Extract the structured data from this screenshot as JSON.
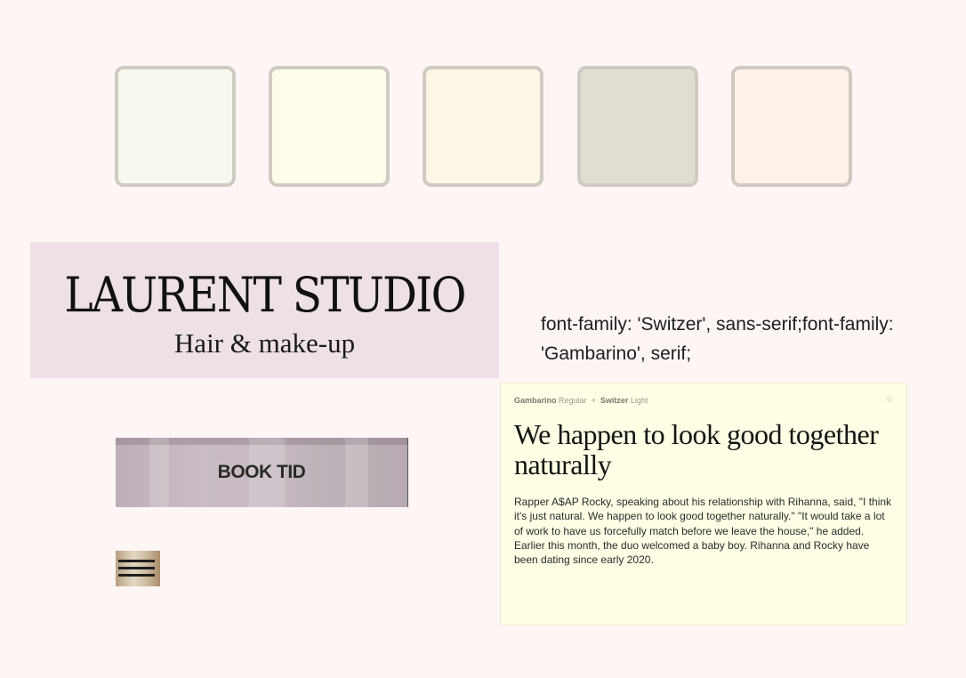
{
  "palette": [
    {
      "color": "#f9f8f0"
    },
    {
      "color": "#fefde9"
    },
    {
      "color": "#fcf6e6"
    },
    {
      "color": "#e2ddd2"
    },
    {
      "color": "#fdf2ea"
    }
  ],
  "brand": {
    "title": "LAURENT STUDIO",
    "subtitle": "Hair & make-up"
  },
  "css_snippet": "font-family: 'Switzer', sans-serif;font-family: 'Gambarino', serif;",
  "book_button": {
    "label": "BOOK TID"
  },
  "menu_button": {
    "icon": "hamburger-menu-icon"
  },
  "font_card": {
    "font1_name": "Gambarino",
    "font1_weight": "Regular",
    "separator": "+",
    "font2_name": "Switzer",
    "font2_weight": "Light",
    "heading": "We happen to look good together naturally",
    "body": "Rapper A$AP Rocky, speaking about his relationship with Rihanna, said, \"I think it's just natural. We happen to look good together naturally.\" \"It would take a lot of work to have us forcefully match before we leave the house,\" he added. Earlier this month, the duo welcomed a baby boy. Rihanna and Rocky have been dating since early 2020.",
    "star_icon": "star-outline-icon"
  },
  "colors": {
    "page_bg": "#fdf6f4",
    "brand_bg": "#ede0e7",
    "card_bg": "#feffe5",
    "swatch_border": "#cfcbc2"
  }
}
